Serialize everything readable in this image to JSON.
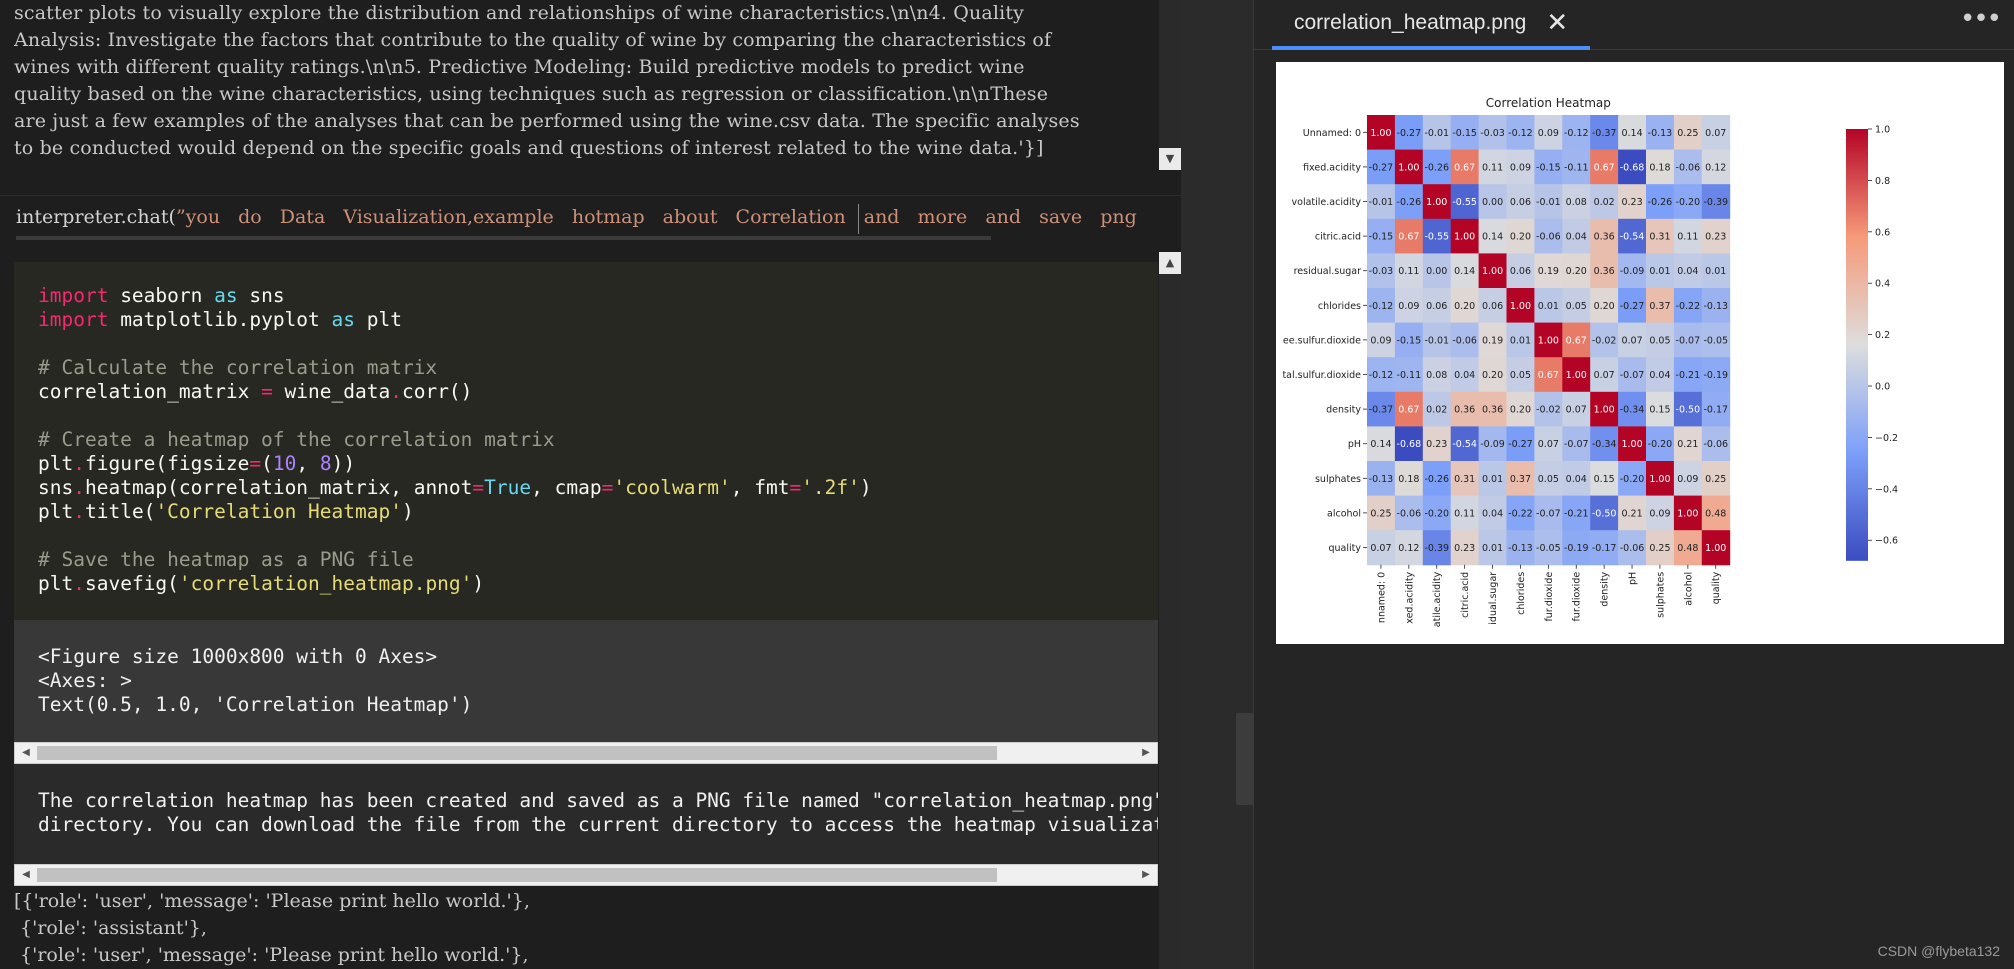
{
  "top_text": [
    "scatter plots to visually explore the distribution and relationships of wine characteristics.\\n\\n4. Quality",
    "Analysis: Investigate the factors that contribute to the quality of wine by comparing the characteristics of",
    "wines with different quality ratings.\\n\\n5. Predictive Modeling: Build predictive models to predict wine",
    "quality based on the wine characteristics, using techniques such as regression or classification.\\n\\nThese",
    "are just a few examples of the analyses that can be performed using the wine.csv data. The specific analyses",
    "to be conducted would depend on the specific goals and questions of interest related to the wine data.'}]"
  ],
  "input": {
    "prefix": "interpreter.chat(",
    "string": "”you do Data Visualization,example hotmap about Correlation and more and save png"
  },
  "code_lines": [
    [
      {
        "t": "import",
        "c": "kw"
      },
      {
        "t": " seaborn ",
        "c": ""
      },
      {
        "t": "as",
        "c": "bi"
      },
      {
        "t": " sns",
        "c": ""
      }
    ],
    [
      {
        "t": "import",
        "c": "kw"
      },
      {
        "t": " matplotlib.pyplot ",
        "c": ""
      },
      {
        "t": "as",
        "c": "bi"
      },
      {
        "t": " plt",
        "c": ""
      }
    ],
    [],
    [
      {
        "t": "# Calculate the correlation matrix",
        "c": "cm"
      }
    ],
    [
      {
        "t": "correlation_matrix ",
        "c": ""
      },
      {
        "t": "=",
        "c": "op"
      },
      {
        "t": " wine_data",
        "c": ""
      },
      {
        "t": ".",
        "c": "op"
      },
      {
        "t": "corr()",
        "c": ""
      }
    ],
    [],
    [
      {
        "t": "# Create a heatmap of the correlation matrix",
        "c": "cm"
      }
    ],
    [
      {
        "t": "plt",
        "c": ""
      },
      {
        "t": ".",
        "c": "op"
      },
      {
        "t": "figure(figsize",
        "c": ""
      },
      {
        "t": "=",
        "c": "op"
      },
      {
        "t": "(",
        "c": ""
      },
      {
        "t": "10",
        "c": "num"
      },
      {
        "t": ", ",
        "c": ""
      },
      {
        "t": "8",
        "c": "num"
      },
      {
        "t": "))",
        "c": ""
      }
    ],
    [
      {
        "t": "sns",
        "c": ""
      },
      {
        "t": ".",
        "c": "op"
      },
      {
        "t": "heatmap(correlation_matrix, annot",
        "c": ""
      },
      {
        "t": "=",
        "c": "op"
      },
      {
        "t": "True",
        "c": "bi"
      },
      {
        "t": ", cmap",
        "c": ""
      },
      {
        "t": "=",
        "c": "op"
      },
      {
        "t": "'coolwarm'",
        "c": "st"
      },
      {
        "t": ", fmt",
        "c": ""
      },
      {
        "t": "=",
        "c": "op"
      },
      {
        "t": "'.2f'",
        "c": "st"
      },
      {
        "t": ")",
        "c": ""
      }
    ],
    [
      {
        "t": "plt",
        "c": ""
      },
      {
        "t": ".",
        "c": "op"
      },
      {
        "t": "title(",
        "c": ""
      },
      {
        "t": "'Correlation Heatmap'",
        "c": "st"
      },
      {
        "t": ")",
        "c": ""
      }
    ],
    [],
    [
      {
        "t": "# Save the heatmap as a PNG file",
        "c": "cm"
      }
    ],
    [
      {
        "t": "plt",
        "c": ""
      },
      {
        "t": ".",
        "c": "op"
      },
      {
        "t": "savefig(",
        "c": ""
      },
      {
        "t": "'correlation_heatmap.png'",
        "c": "st"
      },
      {
        "t": ")",
        "c": ""
      }
    ]
  ],
  "output1": [
    "<Figure size 1000x800 with 0 Axes>",
    "<Axes: >",
    "Text(0.5, 1.0, 'Correlation Heatmap')"
  ],
  "output2": [
    "The correlation heatmap has been created and saved as a PNG file named \"correlation_heatmap.png\"",
    "directory. You can download the file from the current directory to access the heatmap visualizati"
  ],
  "bottom_text": [
    "[{'role': 'user', 'message': 'Please print hello world.'},",
    " {'role': 'assistant'},",
    " {'role': 'user', 'message': 'Please print hello world.'},"
  ],
  "viewer": {
    "tab_name": "correlation_heatmap.png",
    "close_glyph": "✕",
    "more_glyph": "•••",
    "credit": "CSDN @flybeta132"
  },
  "chart_data": {
    "type": "heatmap",
    "title": "Correlation Heatmap",
    "row_labels": [
      "Unnamed: 0",
      "fixed.acidity",
      "volatile.acidity",
      "citric.acid",
      "residual.sugar",
      "chlorides",
      "ee.sulfur.dioxide",
      "tal.sulfur.dioxide",
      "density",
      "pH",
      "sulphates",
      "alcohol",
      "quality"
    ],
    "col_labels": [
      "nnamed: 0",
      "xed.acidity",
      "atile.acidity",
      "citric.acid",
      "idual.sugar",
      "chlorides",
      "fur.dioxide",
      "fur.dioxide",
      "density",
      "pH",
      "sulphates",
      "alcohol",
      "quality"
    ],
    "values": [
      [
        1.0,
        -0.27,
        -0.01,
        -0.15,
        -0.03,
        -0.12,
        0.09,
        -0.12,
        -0.37,
        0.14,
        -0.13,
        0.25,
        0.07
      ],
      [
        -0.27,
        1.0,
        -0.26,
        0.67,
        0.11,
        0.09,
        -0.15,
        -0.11,
        0.67,
        -0.68,
        0.18,
        -0.06,
        0.12
      ],
      [
        -0.01,
        -0.26,
        1.0,
        -0.55,
        0.0,
        0.06,
        -0.01,
        0.08,
        0.02,
        0.23,
        -0.26,
        -0.2,
        -0.39
      ],
      [
        -0.15,
        0.67,
        -0.55,
        1.0,
        0.14,
        0.2,
        -0.06,
        0.04,
        0.36,
        -0.54,
        0.31,
        0.11,
        0.23
      ],
      [
        -0.03,
        0.11,
        0.0,
        0.14,
        1.0,
        0.06,
        0.19,
        0.2,
        0.36,
        -0.09,
        0.01,
        0.04,
        0.01
      ],
      [
        -0.12,
        0.09,
        0.06,
        0.2,
        0.06,
        1.0,
        0.01,
        0.05,
        0.2,
        -0.27,
        0.37,
        -0.22,
        -0.13
      ],
      [
        0.09,
        -0.15,
        -0.01,
        -0.06,
        0.19,
        0.01,
        1.0,
        0.67,
        -0.02,
        0.07,
        0.05,
        -0.07,
        -0.05
      ],
      [
        -0.12,
        -0.11,
        0.08,
        0.04,
        0.2,
        0.05,
        0.67,
        1.0,
        0.07,
        -0.07,
        0.04,
        -0.21,
        -0.19
      ],
      [
        -0.37,
        0.67,
        0.02,
        0.36,
        0.36,
        0.2,
        -0.02,
        0.07,
        1.0,
        -0.34,
        0.15,
        -0.5,
        -0.17
      ],
      [
        0.14,
        -0.68,
        0.23,
        -0.54,
        -0.09,
        -0.27,
        0.07,
        -0.07,
        -0.34,
        1.0,
        -0.2,
        0.21,
        -0.06
      ],
      [
        -0.13,
        0.18,
        -0.26,
        0.31,
        0.01,
        0.37,
        0.05,
        0.04,
        0.15,
        -0.2,
        1.0,
        0.09,
        0.25
      ],
      [
        0.25,
        -0.06,
        -0.2,
        0.11,
        0.04,
        -0.22,
        -0.07,
        -0.21,
        -0.5,
        0.21,
        0.09,
        1.0,
        0.48
      ],
      [
        0.07,
        0.12,
        -0.39,
        0.23,
        0.01,
        -0.13,
        -0.05,
        -0.19,
        -0.17,
        -0.06,
        0.25,
        0.48,
        1.0
      ]
    ],
    "colorbar_ticks": [
      "1.0",
      "0.8",
      "0.6",
      "0.4",
      "0.2",
      "0.0",
      "−0.2",
      "−0.4",
      "−0.6"
    ],
    "colorbar_tick_values": [
      1.0,
      0.8,
      0.6,
      0.4,
      0.2,
      0.0,
      -0.2,
      -0.4,
      -0.6
    ],
    "vmin": -0.68,
    "vmax": 1.0,
    "colormap": "coolwarm"
  }
}
